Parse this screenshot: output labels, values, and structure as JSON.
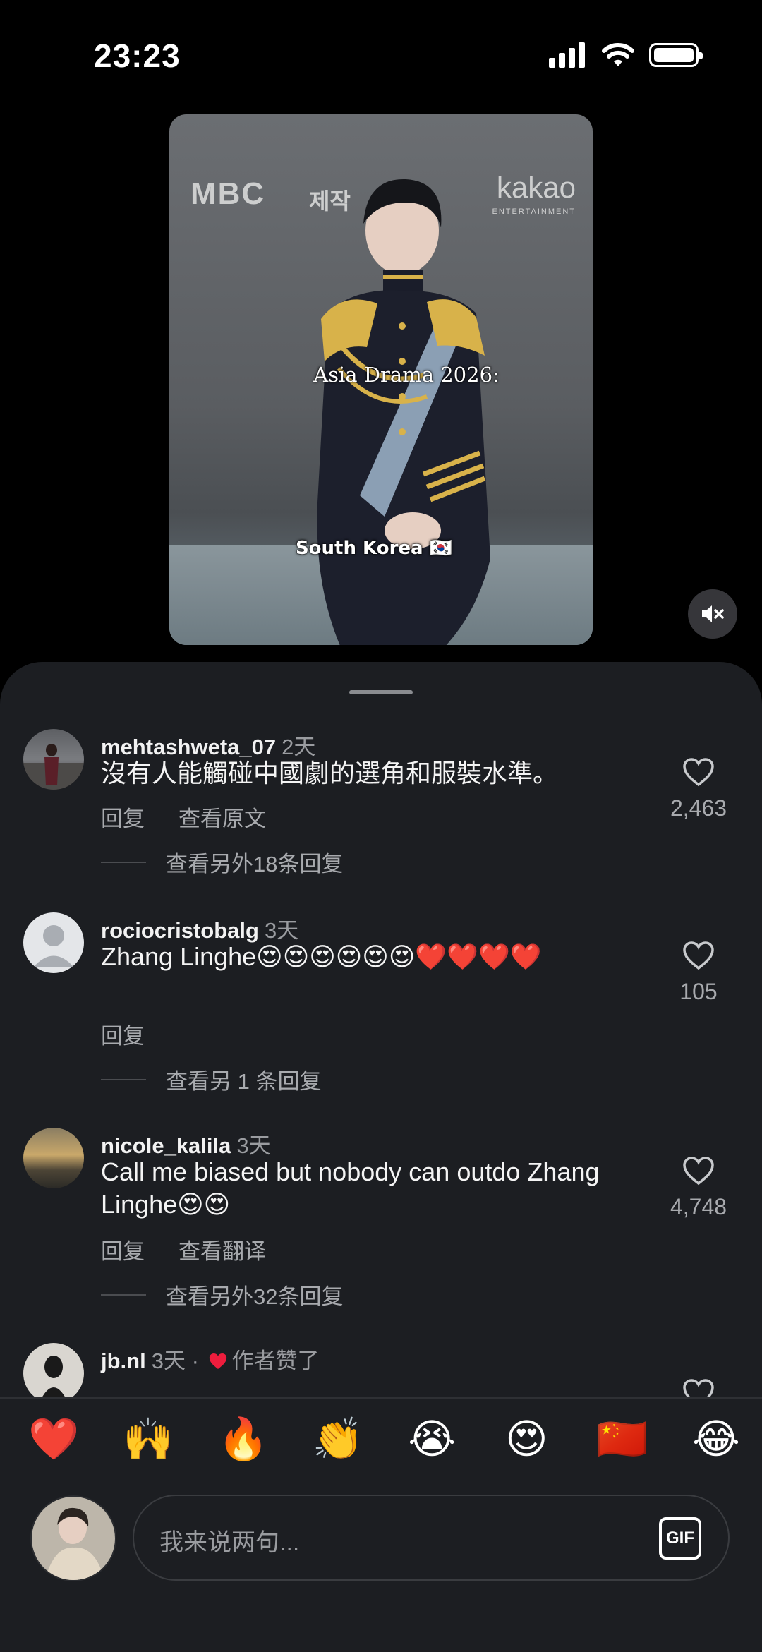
{
  "status": {
    "time": "23:23"
  },
  "video": {
    "brand_left": "MBC",
    "brand_middle": "제작",
    "brand_right": "kakao",
    "brand_right_sub": "ENTERTAINMENT",
    "caption_top": "Asia Drama 2026:",
    "caption_bottom": "South Korea 🇰🇷"
  },
  "comments": [
    {
      "username": "mehtashweta_07",
      "time": "2天",
      "text": "沒有人能觸碰中國劇的選角和服裝水準。",
      "actions": [
        "回复",
        "查看原文"
      ],
      "replies": "查看另外18条回复",
      "likes": "2,463"
    },
    {
      "username": "rociocristobalg",
      "time": "3天",
      "text": "Zhang Linghe😍😍😍😍😍😍❤️❤️❤️❤️",
      "actions": [
        "回复"
      ],
      "replies": "查看另 1 条回复",
      "likes": "105"
    },
    {
      "username": "nicole_kalila",
      "time": "3天",
      "text": "Call me biased but nobody can outdo Zhang Linghe😍😍",
      "actions": [
        "回复",
        "查看翻译"
      ],
      "replies": "查看另外32条回复",
      "likes": "4,748"
    },
    {
      "username": "jb.nl",
      "time": "3天 · ",
      "liked_by_author": "作者赞了"
    }
  ],
  "emojis": [
    "❤️",
    "🙌",
    "🔥",
    "👏",
    "😭",
    "😍",
    "🇨🇳",
    "😂"
  ],
  "composer": {
    "placeholder": "我来说两句...",
    "gif_label": "GIF"
  }
}
